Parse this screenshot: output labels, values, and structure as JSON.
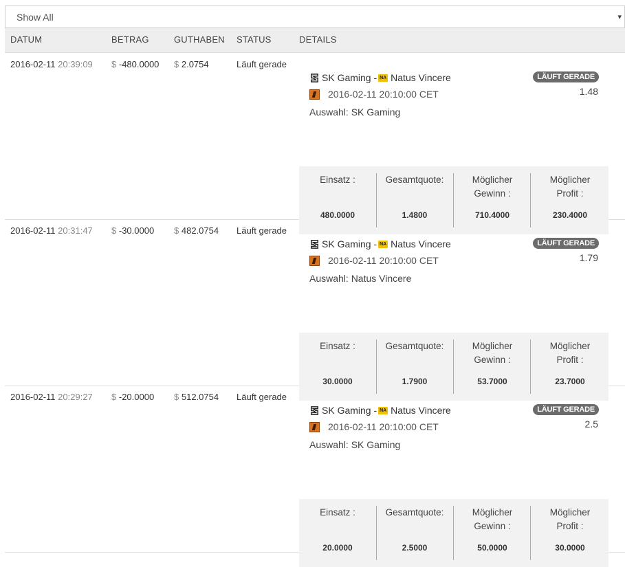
{
  "filter": {
    "value": "Show All",
    "caret": "▾"
  },
  "columns": [
    "DATUM",
    "BETRAG",
    "GUTHABEN",
    "STATUS",
    "DETAILS"
  ],
  "stat_labels": {
    "einsatz": "Einsatz :",
    "gesamtquote": "Gesamtquote:",
    "gewinn_1": "Möglicher",
    "gewinn_2": "Gewinn :",
    "profit_1": "Möglicher",
    "profit_2": "Profit :"
  },
  "rows": [
    {
      "date": "2016-02-11",
      "time": "20:39:09",
      "currency": "$",
      "amount": "-480.0000",
      "balance": "2.0754",
      "status": "Läuft gerade",
      "team1": "SK Gaming",
      "separator": "-",
      "team2": "Natus Vincere",
      "match_time": "2016-02-11 20:10:00 CET",
      "selection": "Auswahl: SK Gaming",
      "badge": "LÄUFT GERADE",
      "odds": "1.48",
      "einsatz": "480.0000",
      "gesamtquote": "1.4800",
      "gewinn": "710.4000",
      "profit": "230.4000"
    },
    {
      "date": "2016-02-11",
      "time": "20:31:47",
      "currency": "$",
      "amount": "-30.0000",
      "balance": "482.0754",
      "status": "Läuft gerade",
      "team1": "SK Gaming",
      "separator": "-",
      "team2": "Natus Vincere",
      "match_time": "2016-02-11 20:10:00 CET",
      "selection": "Auswahl: Natus Vincere",
      "badge": "LÄUFT GERADE",
      "odds": "1.79",
      "einsatz": "30.0000",
      "gesamtquote": "1.7900",
      "gewinn": "53.7000",
      "profit": "23.7000"
    },
    {
      "date": "2016-02-11",
      "time": "20:29:27",
      "currency": "$",
      "amount": "-20.0000",
      "balance": "512.0754",
      "status": "Läuft gerade",
      "team1": "SK Gaming",
      "separator": "-",
      "team2": "Natus Vincere",
      "match_time": "2016-02-11 20:10:00 CET",
      "selection": "Auswahl: SK Gaming",
      "badge": "LÄUFT GERADE",
      "odds": "2.5",
      "einsatz": "20.0000",
      "gesamtquote": "2.5000",
      "gewinn": "50.0000",
      "profit": "30.0000"
    }
  ],
  "icons": {
    "team1": "sk-gaming-logo-icon",
    "team2": "navi-logo-icon",
    "game": "counter-strike-icon"
  }
}
